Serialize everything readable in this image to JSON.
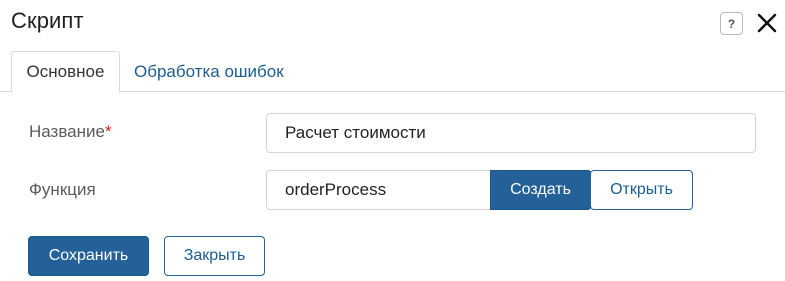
{
  "dialog": {
    "title": "Скрипт",
    "help_label": "?"
  },
  "tabs": [
    {
      "label": "Основное",
      "active": true
    },
    {
      "label": "Обработка ошибок",
      "active": false
    }
  ],
  "form": {
    "name_label": "Название",
    "name_required_mark": "*",
    "name_value": "Расчет стоимости",
    "function_label": "Функция",
    "function_value": "orderProcess",
    "create_label": "Создать",
    "open_label": "Открыть"
  },
  "footer": {
    "save_label": "Сохранить",
    "close_label": "Закрыть"
  },
  "colors": {
    "primary": "#246199",
    "link": "#1d5d8f",
    "required": "#d81c1c"
  }
}
